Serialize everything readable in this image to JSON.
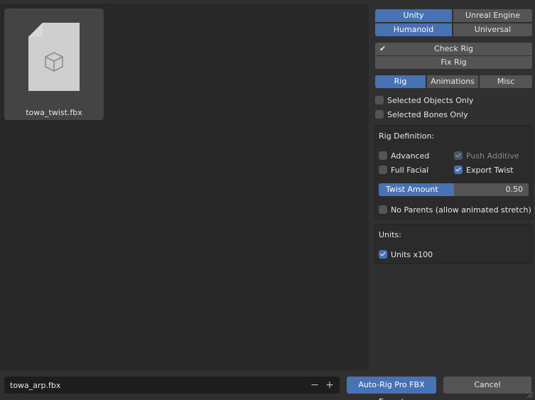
{
  "file_browser": {
    "files": [
      {
        "name": "towa_twist.fbx",
        "icon": "file-cube-icon"
      }
    ]
  },
  "side_panel": {
    "target_engine": {
      "options": [
        "Unity",
        "Unreal Engine"
      ],
      "selected": "Unity"
    },
    "rig_type": {
      "options": [
        "Humanoid",
        "Universal"
      ],
      "selected": "Humanoid"
    },
    "check_rig_label": "Check Rig",
    "fix_rig_label": "Fix Rig",
    "tabs": {
      "options": [
        "Rig",
        "Animations",
        "Misc"
      ],
      "selected": "Rig"
    },
    "selected_objects_only": {
      "label": "Selected Objects Only",
      "checked": false
    },
    "selected_bones_only": {
      "label": "Selected Bones Only",
      "checked": false
    },
    "rig_definition": {
      "title": "Rig Definition:",
      "advanced": {
        "label": "Advanced",
        "checked": false
      },
      "push_additive": {
        "label": "Push Additive",
        "checked": true,
        "enabled": false
      },
      "full_facial": {
        "label": "Full Facial",
        "checked": false
      },
      "export_twist": {
        "label": "Export Twist",
        "checked": true
      },
      "twist_amount": {
        "label": "Twist Amount",
        "value": "0.50",
        "fraction": 0.5
      },
      "no_parents": {
        "label": "No Parents (allow animated stretch)",
        "checked": false
      }
    },
    "units": {
      "title": "Units:",
      "units_x100": {
        "label": "Units x100",
        "checked": true
      }
    }
  },
  "bottom_bar": {
    "filename": "towa_arp.fbx",
    "decrement": "−",
    "increment": "+",
    "export_label": "Auto-Rig Pro FBX Export",
    "cancel_label": "Cancel"
  },
  "colors": {
    "accent": "#4772b3",
    "button": "#545454",
    "panel": "#303030",
    "background": "#282828"
  }
}
